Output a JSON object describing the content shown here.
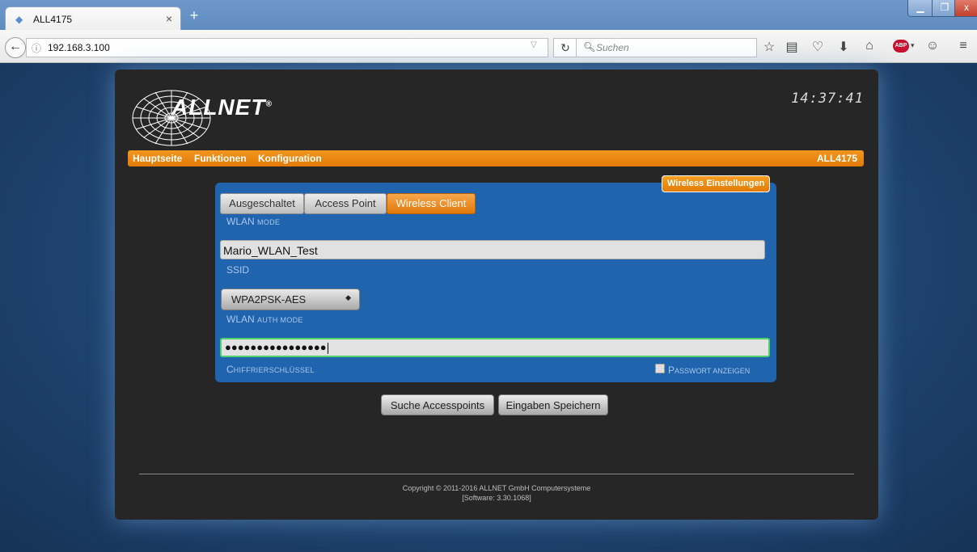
{
  "browser": {
    "tab_title": "ALL4175",
    "tab_close": "×",
    "new_tab": "+",
    "url": "192.168.3.100",
    "search_placeholder": "Suchen",
    "window_min": "▁",
    "window_max": "❐",
    "window_close": "x"
  },
  "header": {
    "logo_text": "ALLNET",
    "logo_reg": "®",
    "clock": "14:37:41"
  },
  "menu": {
    "items": [
      "Hauptseite",
      "Funktionen",
      "Konfiguration"
    ],
    "device": "ALL4175"
  },
  "panel": {
    "title": "Wireless Einstellungen",
    "mode_options": [
      "Ausgeschaltet",
      "Access Point",
      "Wireless Client"
    ],
    "mode_selected": "Wireless Client",
    "mode_label_main": "WLAN",
    "mode_label_small": "mode",
    "ssid_value": "Mario_WLAN_Test",
    "ssid_label": "SSID",
    "auth_value": "WPA2PSK-AES",
    "auth_label_main": "WLAN",
    "auth_label_small": "auth mode",
    "key_value": "●●●●●●●●●●●●●●●●",
    "key_label_first": "C",
    "key_label_rest": "hiffrierschlüssel",
    "show_pw_first": "P",
    "show_pw_rest": "asswort anzeigen"
  },
  "buttons": {
    "scan": "Suche Accesspoints",
    "save": "Eingaben Speichern"
  },
  "footer": {
    "copyright": "Copyright © 2011-2016 ALLNET GmbH Computersysteme",
    "software": "[Software: 3.30.1068]"
  }
}
